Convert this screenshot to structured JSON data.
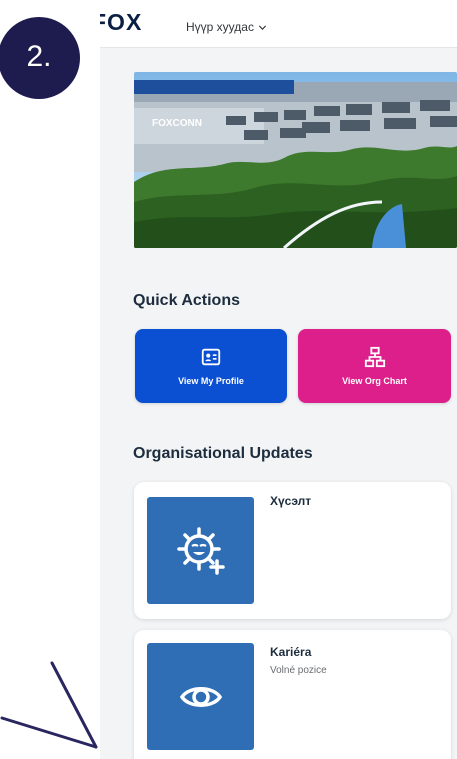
{
  "header": {
    "logo_text": "FOX",
    "home_selector": "Нүүр хуудас"
  },
  "quick_actions": {
    "title": "Quick Actions",
    "tiles": [
      {
        "label": "View My Profile",
        "icon": "profile-card-icon",
        "color": "#0b4fd2"
      },
      {
        "label": "View Org Chart",
        "icon": "org-chart-icon",
        "color": "#dc1f8a"
      }
    ]
  },
  "org_updates": {
    "title": "Organisational Updates",
    "cards": [
      {
        "title": "Хүсэлт",
        "subtitle": "",
        "icon": "gear-plus-icon"
      },
      {
        "title": "Kariéra",
        "subtitle": "Volné pozice",
        "icon": "eye-icon"
      }
    ]
  },
  "hero": {
    "sign_text": "FOXCONN"
  },
  "annotation": {
    "step_label": "2."
  },
  "colors": {
    "accent": "#0b4fd2",
    "magenta": "#dc1f8a",
    "tile_blue": "#2f6eb5",
    "badge": "#1e1b4f"
  }
}
